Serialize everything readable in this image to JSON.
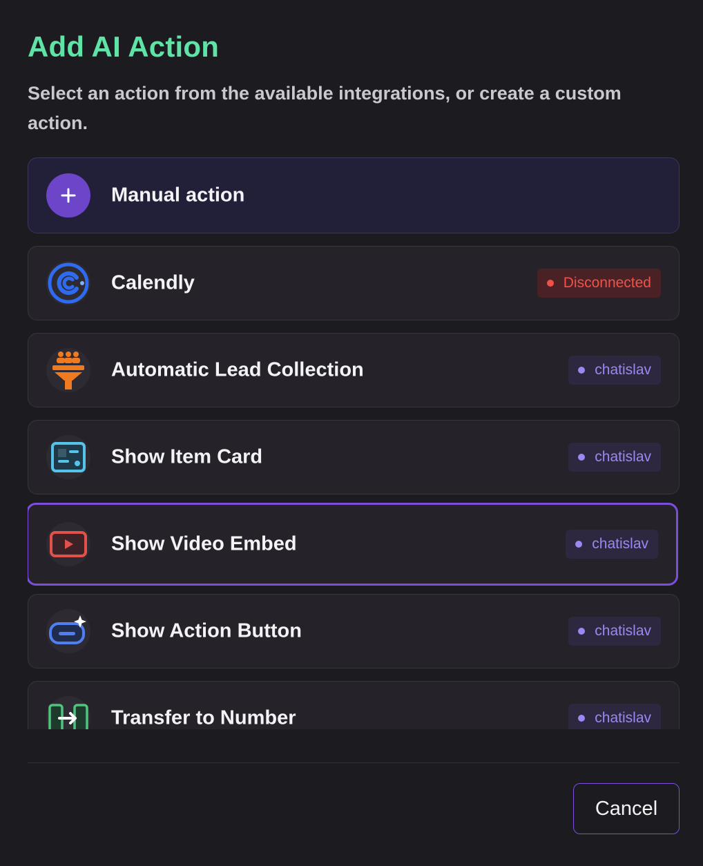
{
  "dialog": {
    "title": "Add AI Action",
    "subtitle": "Select an action from the available integrations, or create a custom action.",
    "cancel_label": "Cancel"
  },
  "actions": [
    {
      "label": "Manual action",
      "icon": "plus-icon",
      "badge": null
    },
    {
      "label": "Calendly",
      "icon": "calendly-logo-icon",
      "badge": "Disconnected",
      "badge_status": "disconnected"
    },
    {
      "label": "Automatic Lead Collection",
      "icon": "lead-funnel-icon",
      "badge": "chatislav",
      "badge_status": "connected"
    },
    {
      "label": "Show Item Card",
      "icon": "item-card-icon",
      "badge": "chatislav",
      "badge_status": "connected"
    },
    {
      "label": "Show Video Embed",
      "icon": "video-play-icon",
      "badge": "chatislav",
      "badge_status": "connected",
      "selected": true
    },
    {
      "label": "Show Action Button",
      "icon": "action-button-icon",
      "badge": "chatislav",
      "badge_status": "connected"
    },
    {
      "label": "Transfer to Number",
      "icon": "phone-transfer-icon",
      "badge": "chatislav",
      "badge_status": "connected"
    }
  ],
  "colors": {
    "title": "#5fe3a6",
    "accent": "#7b4fdc",
    "disconnected": "#f0524a",
    "badge_text": "#9e87f3"
  }
}
